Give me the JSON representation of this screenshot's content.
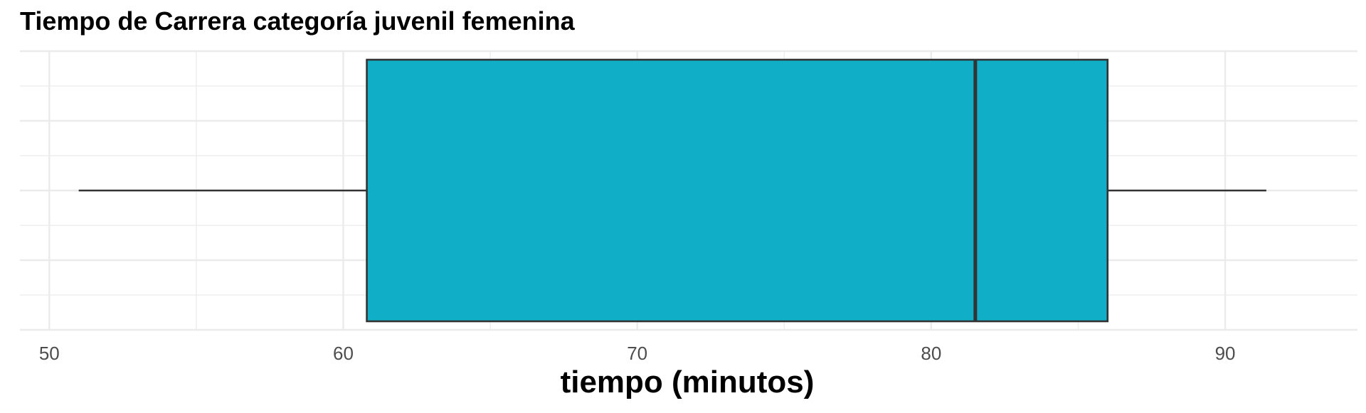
{
  "chart_data": {
    "type": "boxplot",
    "title": "Tiempo de Carrera categoría juvenil femenina",
    "xlabel": "tiempo (minutos)",
    "ylabel": "",
    "orientation": "horizontal",
    "xlim": [
      49,
      94.5
    ],
    "x_ticks": [
      50,
      60,
      70,
      80,
      90
    ],
    "x_tick_labels": [
      "50",
      "60",
      "70",
      "80",
      "90"
    ],
    "grid": true,
    "box": {
      "min": 51,
      "q1": 60.8,
      "median": 81.5,
      "q3": 86.0,
      "max": 91.4
    },
    "colors": {
      "fill": "#10AFC7",
      "stroke": "#333333",
      "grid": "#EBEBEB"
    }
  }
}
